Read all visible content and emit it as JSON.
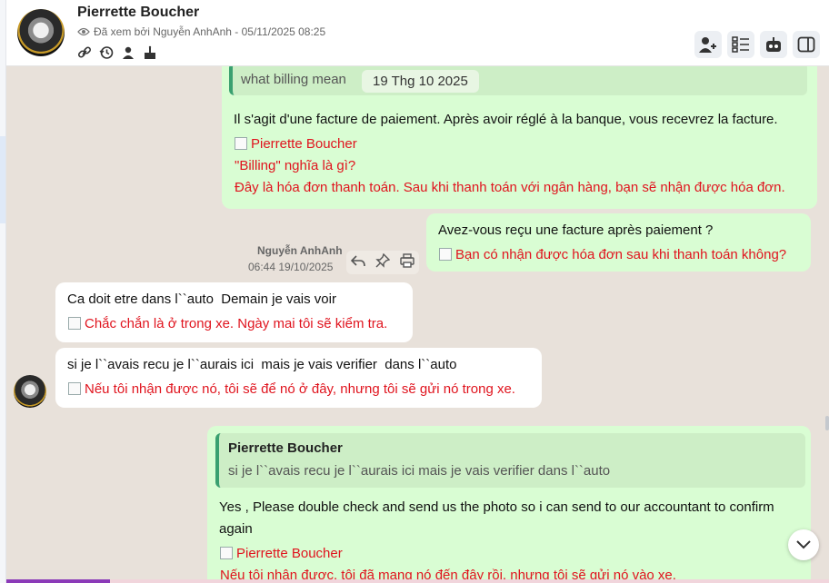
{
  "header": {
    "name": "Pierrette Boucher",
    "seen_text": "Đã xem bởi Nguyễn AnhAnh - 05/11/2025 08:25",
    "icons": [
      "link-icon",
      "history-icon",
      "person-icon",
      "cake-icon"
    ],
    "tools": [
      "add-user-icon",
      "checklist-icon",
      "bot-icon",
      "sidebar-toggle-icon"
    ]
  },
  "messages": {
    "m1": {
      "quote_text": "what billing mean",
      "quote_date": "19 Thg 10 2025",
      "text": "Il s'agit d'une facture de paiement. Après avoir réglé à la banque, vous recevrez la facture.",
      "tr_name": "Pierrette Boucher",
      "tr_line1": "\"Billing\" nghĩa là gì?",
      "tr_line2": "Đây là hóa đơn thanh toán. Sau khi thanh toán với ngân hàng, bạn sẽ nhận được hóa đơn."
    },
    "m2": {
      "text": "Avez-vous reçu une facture après paiement ?",
      "tr": "Bạn có nhận được hóa đơn sau khi thanh toán không?",
      "sender": "Nguyễn AnhAnh",
      "time": "06:44 19/10/2025"
    },
    "m3": {
      "text": "Ca doit etre dans l``auto  Demain je vais voir",
      "tr": "Chắc chắn là ở trong xe. Ngày mai tôi sẽ kiểm tra."
    },
    "m4": {
      "text": "si je l``avais recu je l``aurais ici  mais je vais verifier  dans l``auto",
      "tr": "Nếu tôi nhận được nó, tôi sẽ để nó ở đây, nhưng tôi sẽ gửi nó trong xe."
    },
    "m5": {
      "quote_name": "Pierrette Boucher",
      "quote_text": "si je l``avais recu je l``aurais ici mais je vais verifier dans l``auto",
      "text": "Yes , Please double check and send us the photo so i can send to our accountant to confirm again",
      "tr_name": "Pierrette Boucher",
      "tr": "Nếu tôi nhận được, tôi đã mang nó đến đây rồi, nhưng tôi sẽ gửi nó vào xe."
    }
  },
  "colors": {
    "outgoing_bubble": "#d9fdd3",
    "incoming_bubble": "#ffffff",
    "chat_background": "#e8e1da",
    "translation_text": "#e0141e",
    "quote_bar": "#3aa070"
  }
}
